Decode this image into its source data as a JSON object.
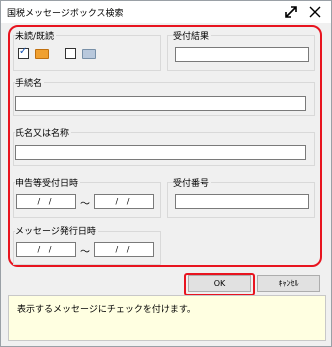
{
  "window": {
    "title": "国税メッセージボックス検索"
  },
  "read_status": {
    "label": "未読/既読",
    "unread_checked": true,
    "read_checked": false,
    "unread_icon_color": "#f0a030",
    "read_icon_color": "#b8c8dc"
  },
  "receipt_result": {
    "label": "受付結果",
    "value": ""
  },
  "procedure_name": {
    "label": "手続名",
    "value": ""
  },
  "name": {
    "label": "氏名又は名称",
    "value": ""
  },
  "filing_date": {
    "label": "申告等受付日時",
    "from": "/ /",
    "separator": "～",
    "to": "/ /"
  },
  "receipt_number": {
    "label": "受付番号",
    "value": ""
  },
  "message_date": {
    "label": "メッセージ発行日時",
    "from": "/ /",
    "separator": "～",
    "to": "/ /"
  },
  "buttons": {
    "ok": "OK",
    "cancel": "ｷｬﾝｾﾙ"
  },
  "status_message": "表示するメッセージにチェックを付けます。",
  "accent_color": "#e8141f"
}
